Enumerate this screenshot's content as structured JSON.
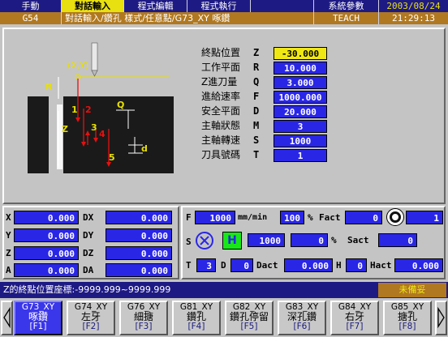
{
  "menu_tabs": [
    {
      "label": "手動",
      "active": false
    },
    {
      "label": "對話輸入",
      "active": true
    },
    {
      "label": "程式編輯",
      "active": false
    },
    {
      "label": "程式執行",
      "active": false
    },
    {
      "label": "系統參數",
      "active": false
    }
  ],
  "date": "2003/08/24",
  "row2": {
    "code": "G54",
    "title": "對話輸入/鑽孔 樣式/任意點/G73_XY 啄鑽",
    "mode": "TEACH",
    "time": "21:29:13"
  },
  "diagram": {
    "xy_label": "(X,Y)",
    "r": "R",
    "z": "Z",
    "q": "Q",
    "d": "d",
    "n1": "1",
    "n2": "2",
    "n3": "3",
    "n4": "4",
    "n5": "5"
  },
  "params": [
    {
      "label": "終點位置",
      "code": "Z",
      "value": "-30.000",
      "highlight": true
    },
    {
      "label": "工作平面",
      "code": "R",
      "value": "10.000",
      "highlight": false
    },
    {
      "label": "Z進刀量",
      "code": "Q",
      "value": "3.000",
      "highlight": false
    },
    {
      "label": "進給速率",
      "code": "F",
      "value": "1000.000",
      "highlight": false
    },
    {
      "label": "安全平面",
      "code": "D",
      "value": "20.000",
      "highlight": false
    },
    {
      "label": "主軸狀態",
      "code": "M",
      "value": "3",
      "highlight": false
    },
    {
      "label": "主軸轉速",
      "code": "S",
      "value": "1000",
      "highlight": false
    },
    {
      "label": "刀具號碼",
      "code": "T",
      "value": "1",
      "highlight": false
    }
  ],
  "coords": [
    {
      "axis": "X",
      "value": "0.000",
      "daxis": "DX",
      "dvalue": "0.000"
    },
    {
      "axis": "Y",
      "value": "0.000",
      "daxis": "DY",
      "dvalue": "0.000"
    },
    {
      "axis": "Z",
      "value": "0.000",
      "daxis": "DZ",
      "dvalue": "0.000"
    },
    {
      "axis": "A",
      "value": "0.000",
      "daxis": "DA",
      "dvalue": "0.000"
    }
  ],
  "status": {
    "f_label": "F",
    "f_value": "1000",
    "f_unit": "mm/min",
    "pct1": "100",
    "pct_sign1": "%",
    "fact_label": "Fact",
    "fact_value": "0",
    "fact_right": "1",
    "s_label": "S",
    "h_label": "H",
    "s_value": "1000",
    "s_pct": "0",
    "pct_sign2": "%",
    "sact_label": "Sact",
    "sact_value": "0",
    "t_label": "T",
    "t_value": "3",
    "d_label": "D",
    "d_value": "0",
    "dact_label": "Dact",
    "dact_value": "0.000",
    "h2_label": "H",
    "h2_value": "0",
    "hact_label": "Hact",
    "hact_value": "0.000"
  },
  "message": "Z的終點位置座標:-9999.999~9999.999",
  "message_status": "未備妥",
  "softkeys": [
    {
      "code": "G73_XY",
      "name": "啄鑽",
      "key": "[F1]",
      "active": true
    },
    {
      "code": "G74_XY",
      "name": "左牙",
      "key": "[F2]",
      "active": false
    },
    {
      "code": "G76_XY",
      "name": "細搪",
      "key": "[F3]",
      "active": false
    },
    {
      "code": "G81_XY",
      "name": "鑽孔",
      "key": "[F4]",
      "active": false
    },
    {
      "code": "G82_XY",
      "name": "鑽孔停留",
      "key": "[F5]",
      "active": false
    },
    {
      "code": "G83_XY",
      "name": "深孔鑽",
      "key": "[F6]",
      "active": false
    },
    {
      "code": "G84_XY",
      "name": "右牙",
      "key": "[F7]",
      "active": false
    },
    {
      "code": "G85_XY",
      "name": "搪孔",
      "key": "[F8]",
      "active": false
    }
  ]
}
